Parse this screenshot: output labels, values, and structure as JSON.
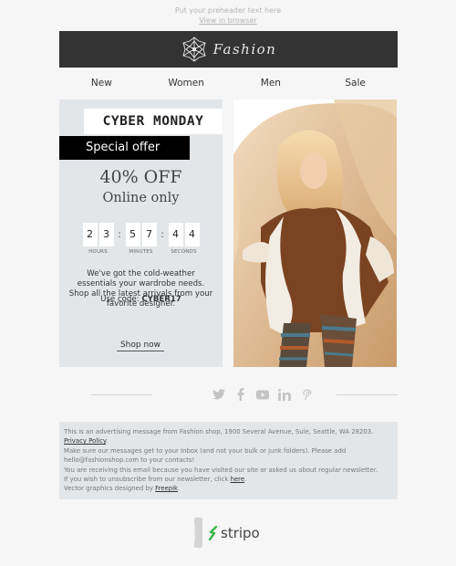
{
  "preheader": {
    "text": "Put your preheader text here",
    "view_link": "View in browser"
  },
  "header": {
    "brand": "Fashion",
    "logo_icon": "snowflake-ornament-icon"
  },
  "nav": {
    "items": [
      {
        "label": "New"
      },
      {
        "label": "Women"
      },
      {
        "label": "Men"
      },
      {
        "label": "Sale"
      }
    ]
  },
  "promo": {
    "banner": "CYBER MONDAY",
    "tag": "Special offer",
    "headline": "40% OFF",
    "subheadline": "Online only",
    "countdown": {
      "hours": [
        "2",
        "3"
      ],
      "minutes": [
        "5",
        "7"
      ],
      "seconds": [
        "4",
        "4"
      ],
      "separator": ":",
      "labels": {
        "hours": "HOURS",
        "minutes": "MINUTES",
        "seconds": "SECONDS"
      }
    },
    "description": "We've got the cold-weather essentials your wardrobe needs. Shop all the latest arrivals from your favorite designer.",
    "code_label": "Use code:",
    "code_value": "CYBER17",
    "cta": "Shop now"
  },
  "hero": {
    "alt": "Model in shearling coat seated in wicker chair"
  },
  "social": {
    "icons": [
      "twitter-icon",
      "facebook-icon",
      "youtube-icon",
      "linkedin-icon",
      "pinterest-icon"
    ]
  },
  "footer": {
    "line1": "This is an advertising message from Fashion shop, 1900 Several Avenue, Sule, Seattle, WA 28203.",
    "privacy_link": "Privacy Policy",
    "line2": "Make sure our messages get to your Inbox (and not your bulk or junk folders). Please add hello@fashionshop.com to your contacts!",
    "line3": "You are receiving this email because you have visited our site or asked us about regular newsletter.",
    "line4_prefix": "If you wish to unsubscribe from our newsletter, click",
    "unsubscribe_link": "here",
    "line5_prefix": "Vector graphics designed by",
    "freepik_link": "Freepik"
  },
  "badge": {
    "made_with": "MADE WITH",
    "wordmark": "stripo"
  },
  "colors": {
    "background": "#f6f6f6",
    "header_bg": "#333333",
    "panel_bg": "#e3e6e9",
    "tag_bg": "#000000",
    "stripo_green": "#3cb64a"
  }
}
